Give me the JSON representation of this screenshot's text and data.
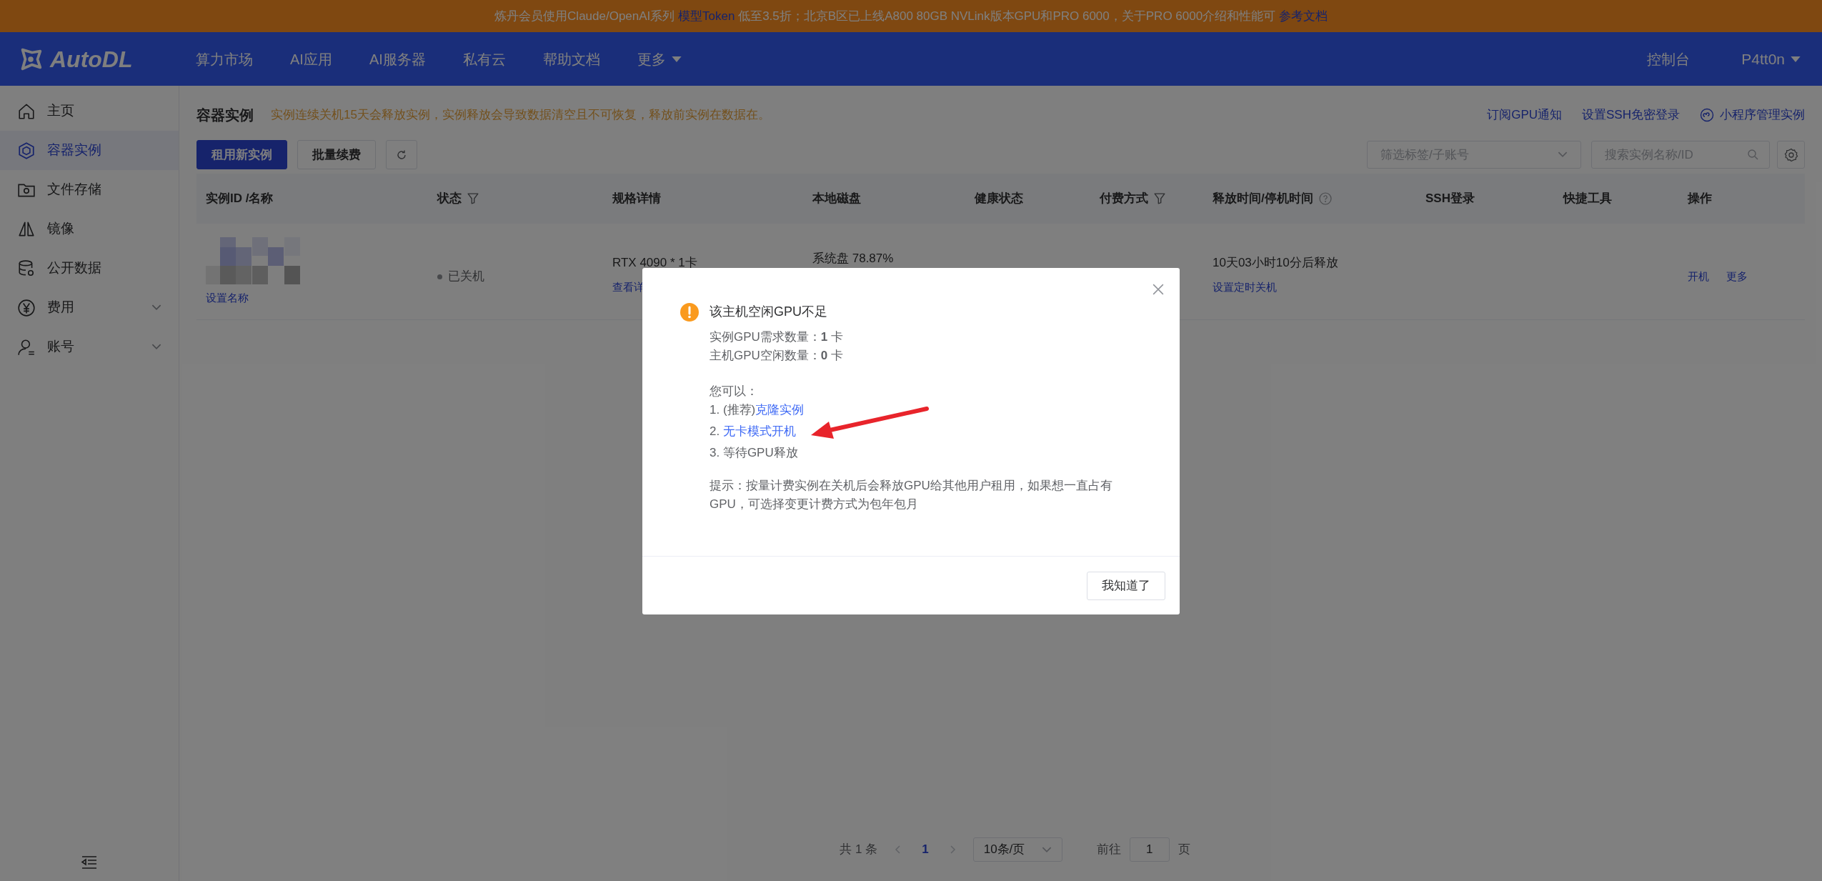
{
  "banner": {
    "parts": [
      {
        "kind": "text",
        "text": "炼丹会员使用Claude/OpenAI系列 "
      },
      {
        "kind": "link",
        "text": "模型Token"
      },
      {
        "kind": "text",
        "text": " 低至3.5折；北京B区已上线A800 80GB NVLink版本GPU和PRO 6000，关于PRO 6000介绍和性能可 "
      },
      {
        "kind": "link",
        "text": "参考文档"
      }
    ]
  },
  "nav": {
    "logo": "AutoDL",
    "items": [
      {
        "label": "算力市场",
        "kind": "link"
      },
      {
        "label": "AI应用",
        "kind": "link"
      },
      {
        "label": "AI服务器",
        "kind": "link"
      },
      {
        "label": "私有云",
        "kind": "link"
      },
      {
        "label": "帮助文档",
        "kind": "link"
      },
      {
        "label": "更多",
        "kind": "menu"
      }
    ],
    "console": "控制台",
    "user": "P4tt0n"
  },
  "sidebar": {
    "items": [
      {
        "label": "主页",
        "kind": "link",
        "selected": false
      },
      {
        "label": "容器实例",
        "kind": "link",
        "selected": true
      },
      {
        "label": "文件存储",
        "kind": "link",
        "selected": false
      },
      {
        "label": "镜像",
        "kind": "link",
        "selected": false
      },
      {
        "label": "公开数据",
        "kind": "link",
        "selected": false
      },
      {
        "label": "费用",
        "kind": "group",
        "selected": false
      },
      {
        "label": "账号",
        "kind": "group",
        "selected": false
      }
    ]
  },
  "page": {
    "title": "容器实例",
    "notice": "实例连续关机15天会释放实例，实例释放会导致数据清空且不可恢复，释放前实例在数据在。",
    "links": [
      {
        "label": "订阅GPU通知",
        "kind": "plain"
      },
      {
        "label": "设置SSH免密登录",
        "kind": "plain"
      },
      {
        "label": "小程序管理实例",
        "kind": "mini"
      }
    ],
    "buttons": [
      {
        "label": "租用新实例",
        "kind": "primary"
      },
      {
        "label": "批量续费",
        "kind": "default"
      }
    ],
    "filter": {
      "placeholder": "筛选标签/子账号"
    },
    "search": {
      "placeholder": "搜索实例名称/ID"
    }
  },
  "table": {
    "columns": [
      {
        "label": "实例ID /名称",
        "kind": "plain"
      },
      {
        "label": "状态",
        "kind": "filter"
      },
      {
        "label": "规格详情",
        "kind": "plain"
      },
      {
        "label": "本地磁盘",
        "kind": "plain"
      },
      {
        "label": "健康状态",
        "kind": "plain"
      },
      {
        "label": "付费方式",
        "kind": "filter"
      },
      {
        "label": "释放时间/停机时间",
        "kind": "help"
      },
      {
        "label": "SSH登录",
        "kind": "plain"
      },
      {
        "label": "快捷工具",
        "kind": "plain"
      },
      {
        "label": "操作",
        "kind": "plain"
      }
    ],
    "rows": [
      {
        "name_link": "设置名称",
        "status": "已关机",
        "spec": "RTX 4090 * 1卡",
        "spec_link": "查看详",
        "disk": "系统盘 78.87%",
        "release": "10天03小时10分后释放",
        "release_link": "设置定时关机",
        "actions": [
          "开机",
          "更多"
        ]
      }
    ]
  },
  "pagination": {
    "total": "共 1 条",
    "pages": [
      {
        "label": "1",
        "selected": true
      }
    ],
    "page_size": "10条/页",
    "goto_label": "前往",
    "goto_value": "1",
    "goto_unit": "页"
  },
  "dialog": {
    "title": "该主机空闲GPU不足",
    "lines": [
      "实例GPU需求数量：**1** 卡",
      "主机GPU空闲数量：**0** 卡"
    ],
    "options_title": "您可以：",
    "options": [
      {
        "prefix": "1. (推荐)",
        "link": "克隆实例"
      },
      {
        "prefix": "2. ",
        "link": "无卡模式开机"
      },
      {
        "prefix": "3. 等待GPU释放"
      }
    ],
    "hint": "提示：按量计费实例在关机后会释放GPU给其他用户租用，如果想一直占有GPU，可选择变更计费方式为包年包月",
    "button": "我知道了"
  }
}
